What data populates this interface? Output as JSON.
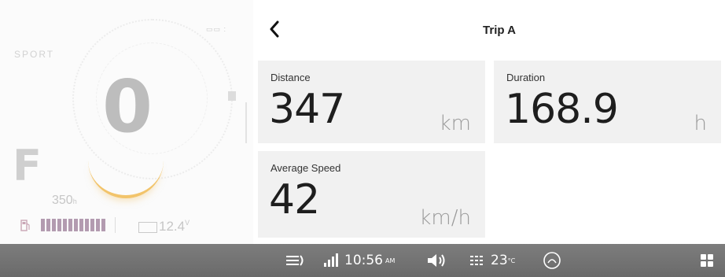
{
  "cluster": {
    "mode": "SPORT",
    "speed": "0",
    "gear": "F",
    "range_value": "350",
    "range_unit": "h",
    "voltage_value": "12.4",
    "voltage_unit": "V",
    "fuel_level_fraction": 0.85
  },
  "trip": {
    "title": "Trip A",
    "distance": {
      "label": "Distance",
      "value": "347",
      "unit": "km"
    },
    "duration": {
      "label": "Duration",
      "value": "168.9",
      "unit": "h"
    },
    "average_speed": {
      "label": "Average Speed",
      "value": "42",
      "unit": "km/h"
    }
  },
  "statusbar": {
    "time": "10:56",
    "ampm": "AM",
    "temperature": "23",
    "temperature_unit": "°C",
    "icons": [
      "headlight-icon",
      "signal-icon",
      "volume-icon",
      "heat-icon",
      "driver-profile-icon",
      "apps-grid-icon"
    ]
  }
}
